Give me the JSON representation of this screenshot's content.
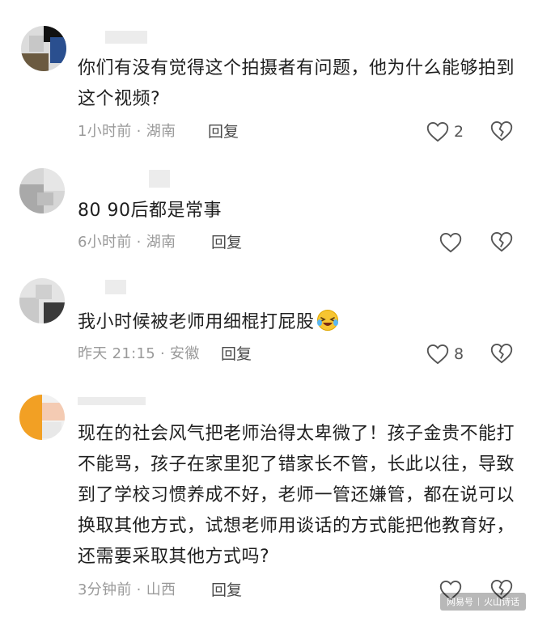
{
  "comments": [
    {
      "text": "你们有没有觉得这个拍摄者有问题，他为什么能够拍到这个视频?",
      "time_location": "1小时前 · 湖南",
      "reply_label": "回复",
      "like_count": "2",
      "like_icon": "heart-outline-icon",
      "dislike_icon": "broken-heart-icon"
    },
    {
      "text": "80 90后都是常事",
      "time_location": "6小时前 · 湖南",
      "reply_label": "回复",
      "like_count": "",
      "like_icon": "heart-outline-icon",
      "dislike_icon": "broken-heart-icon"
    },
    {
      "text": "我小时候被老师用细棍打屁股",
      "emoji": "laughing-crying-emoji",
      "time_location": "昨天 21:15 · 安徽",
      "reply_label": "回复",
      "like_count": "8",
      "like_icon": "heart-outline-icon",
      "dislike_icon": "broken-heart-icon"
    },
    {
      "text": "现在的社会风气把老师治得太卑微了！孩子金贵不能打不能骂，孩子在家里犯了错家长不管，长此以往，导致到了学校习惯养成不好，老师一管还嫌管，都在说可以换取其他方式，试想老师用谈话的方式能把他教育好，还需要采取其他方式吗?",
      "time_location": "3分钟前 · 山西",
      "reply_label": "回复",
      "like_count": "",
      "like_icon": "heart-outline-icon",
      "dislike_icon": "broken-heart-icon"
    }
  ],
  "watermark": {
    "left": "网易号",
    "right": "火山诗话"
  },
  "colors": {
    "text": "#1f1f1f",
    "meta": "#9a9a9a",
    "icon": "#555555"
  }
}
